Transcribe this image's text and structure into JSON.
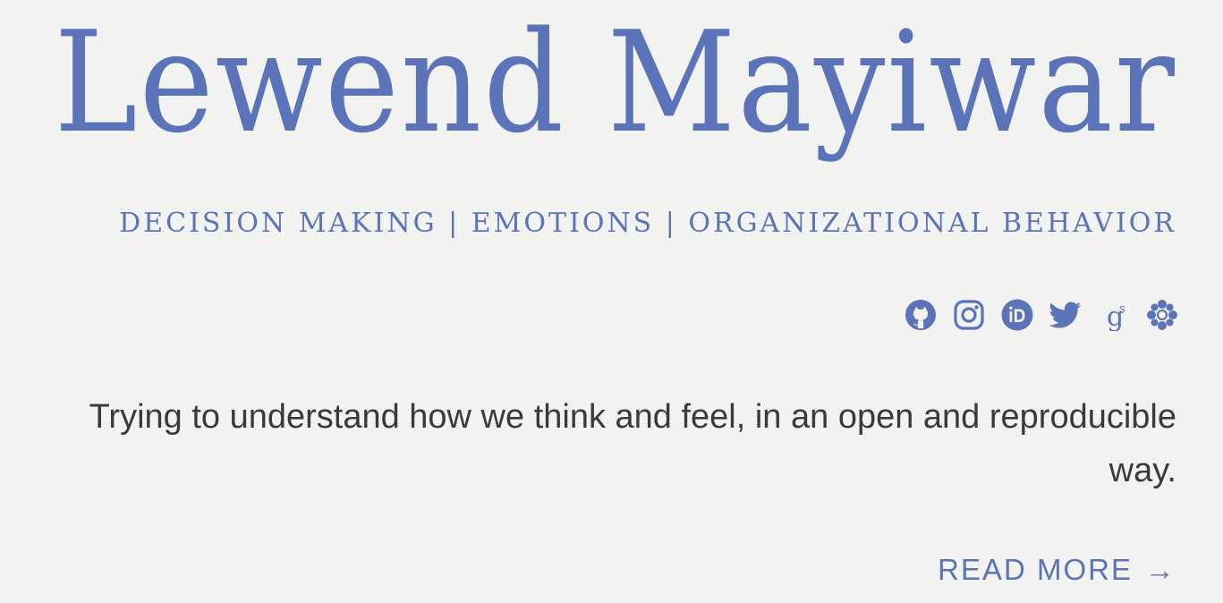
{
  "header": {
    "title": "Lewend Mayiwar",
    "subtitle": "DECISION MAKING | EMOTIONS | ORGANIZATIONAL BEHAVIOR"
  },
  "socials": [
    {
      "icon": "github-icon"
    },
    {
      "icon": "instagram-icon"
    },
    {
      "icon": "orcid-icon"
    },
    {
      "icon": "twitter-icon"
    },
    {
      "icon": "google-scholar-icon"
    },
    {
      "icon": "osf-icon"
    }
  ],
  "main": {
    "tagline": "Trying to understand how we think and feel, in an open and reproducible way.",
    "read_more_label": "READ MORE",
    "read_more_arrow": "→"
  },
  "colors": {
    "accent": "#5b73b8",
    "background": "#f2f2f1",
    "text": "#3a3a3a"
  }
}
